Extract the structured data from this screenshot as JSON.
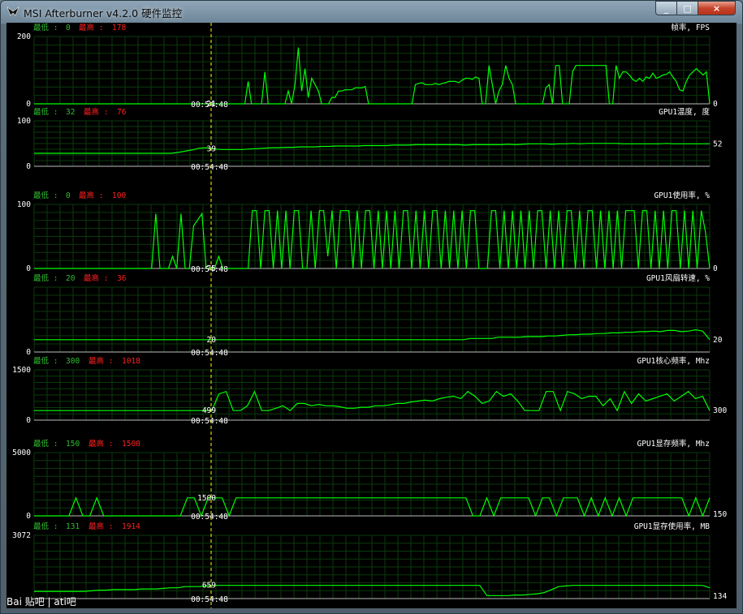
{
  "window": {
    "title": "MSI Afterburner v4.2.0 硬件监控",
    "controls": {
      "minimize": "_",
      "maximize": "□",
      "close": "×"
    }
  },
  "labels": {
    "min_label": "最低 :",
    "max_label": "最高 :"
  },
  "colors": {
    "line": "#00ff00",
    "grid": "#0b3a0b",
    "min_text": "#2fbf2f",
    "max_text": "#ff2020",
    "cursor": "#ffff00"
  },
  "cursor": {
    "time": "00:54:48"
  },
  "graphs": [
    {
      "id": "fps",
      "title": "帧率, FPS",
      "min": "0",
      "max": "178",
      "ymax": "200",
      "ymin": "0",
      "ymax_value": 200,
      "current": "0",
      "cursor_value": "21"
    },
    {
      "id": "gpu-temp",
      "title": "GPU1温度, 度",
      "min": "32",
      "max": "76",
      "ymax": "100",
      "ymin": "0",
      "ymax_value": 100,
      "current": "52",
      "cursor_value": "39"
    },
    {
      "id": "gpu-usage",
      "title": "GPU1使用率, %",
      "min": "0",
      "max": "100",
      "ymax": "100",
      "ymin": "0",
      "ymax_value": 100,
      "current": "0",
      "cursor_value": "75"
    },
    {
      "id": "fan",
      "title": "GPU1风扇转速, %",
      "min": "20",
      "max": "36",
      "ymax": "",
      "ymin": "0",
      "ymax_value": 100,
      "current": "20",
      "cursor_value": "20"
    },
    {
      "id": "core-clock",
      "title": "GPU1核心频率, Mhz",
      "min": "300",
      "max": "1018",
      "ymax": "1500",
      "ymin": "0",
      "ymax_value": 1500,
      "current": "300",
      "cursor_value": "499"
    },
    {
      "id": "mem-clock",
      "title": "GPU1显存频率, Mhz",
      "min": "150",
      "max": "1500",
      "ymax": "5000",
      "ymin": "0",
      "ymax_value": 5000,
      "current": "150",
      "cursor_value": "1500"
    },
    {
      "id": "mem-usage",
      "title": "GPU1显存使用率, MB",
      "min": "131",
      "max": "1914",
      "ymax": "3072",
      "ymin": "",
      "ymax_value": 3072,
      "current": "134",
      "cursor_value": "659"
    }
  ],
  "watermark": {
    "text": "Bai 贴吧 | ati吧"
  }
}
